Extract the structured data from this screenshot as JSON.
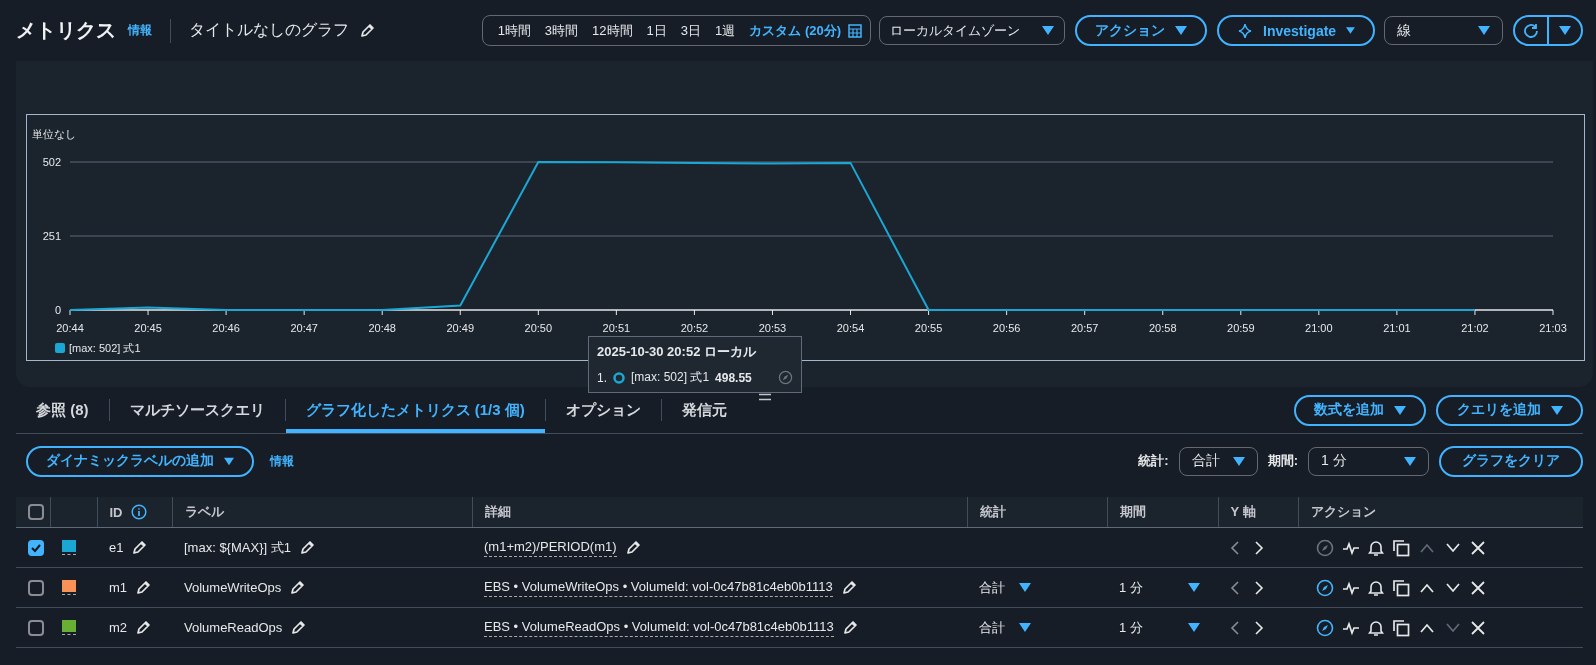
{
  "header": {
    "title": "メトリクス",
    "info": "情報",
    "graph_title": "タイトルなしのグラフ"
  },
  "time_ranges": [
    {
      "label": "1時間",
      "selected": false
    },
    {
      "label": "3時間",
      "selected": false
    },
    {
      "label": "12時間",
      "selected": false
    },
    {
      "label": "1日",
      "selected": false
    },
    {
      "label": "3日",
      "selected": false
    },
    {
      "label": "1週",
      "selected": false
    },
    {
      "label": "カスタム (20分)",
      "selected": true
    }
  ],
  "timezone": "ローカルタイムゾーン",
  "actions_button": "アクション",
  "investigate_button": "Investigate",
  "chart_type": "線",
  "chart": {
    "chart_data": {
      "type": "line",
      "ylabel": "単位なし",
      "categories": [
        "20:44",
        "20:45",
        "20:46",
        "20:47",
        "20:48",
        "20:49",
        "20:50",
        "20:51",
        "20:52",
        "20:53",
        "20:54",
        "20:55",
        "20:56",
        "20:57",
        "20:58",
        "20:59",
        "21:00",
        "21:01",
        "21:02",
        "21:03"
      ],
      "yticks": [
        0,
        251,
        502
      ],
      "ylim": [
        0,
        502
      ],
      "series": [
        {
          "name": "[max: 502] 式1",
          "color": "#1ba7d4",
          "values": [
            0,
            8,
            0,
            0,
            0,
            15,
            502,
            501,
            499,
            497,
            499,
            0,
            0,
            0,
            0,
            0,
            0,
            0,
            0,
            null
          ]
        }
      ]
    }
  },
  "tooltip": {
    "title": "2025-10-30 20:52 ローカル",
    "items": [
      {
        "index": "1.",
        "label": "[max: 502] 式1",
        "value": "498.55",
        "color": "#1ba7d4"
      }
    ]
  },
  "tabs": [
    {
      "label": "参照 (8)",
      "selected": false
    },
    {
      "label": "マルチソースクエリ",
      "selected": false
    },
    {
      "label": "グラフ化したメトリクス (1/3 個)",
      "selected": true
    },
    {
      "label": "オプション",
      "selected": false
    },
    {
      "label": "発信元",
      "selected": false
    }
  ],
  "add_math": "数式を追加",
  "add_query": "クエリを追加",
  "dynamic_label": "ダイナミックラベルの追加",
  "info": "情報",
  "stat_label": "統計:",
  "stat_value": "合計",
  "period_label": "期間:",
  "period_value": "1 分",
  "clear_button": "グラフをクリア",
  "table": {
    "all_checked": false,
    "columns": [
      "ID",
      "ラベル",
      "詳細",
      "統計",
      "期間",
      "Y 軸",
      "アクション"
    ],
    "rows": [
      {
        "checked": true,
        "color": "#1ba7d4",
        "id": "e1",
        "label": "[max: ${MAX}] 式1",
        "details": "(m1+m2)/PERIOD(m1)",
        "browse_enabled": false,
        "can_move_up": false,
        "can_move_down": true
      },
      {
        "checked": false,
        "color": "#f89256",
        "id": "m1",
        "label": "VolumeWriteOps",
        "details": "EBS • VolumeWriteOps • VolumeId: vol-0c47b81c4eb0b1113",
        "stat": "合計",
        "period": "1 分",
        "browse_enabled": true,
        "can_move_up": true,
        "can_move_down": true
      },
      {
        "checked": false,
        "color": "#6aaf35",
        "id": "m2",
        "label": "VolumeReadOps",
        "details": "EBS • VolumeReadOps • VolumeId: vol-0c47b81c4eb0b1113",
        "stat": "合計",
        "period": "1 分",
        "browse_enabled": true,
        "can_move_up": true,
        "can_move_down": false
      }
    ]
  }
}
